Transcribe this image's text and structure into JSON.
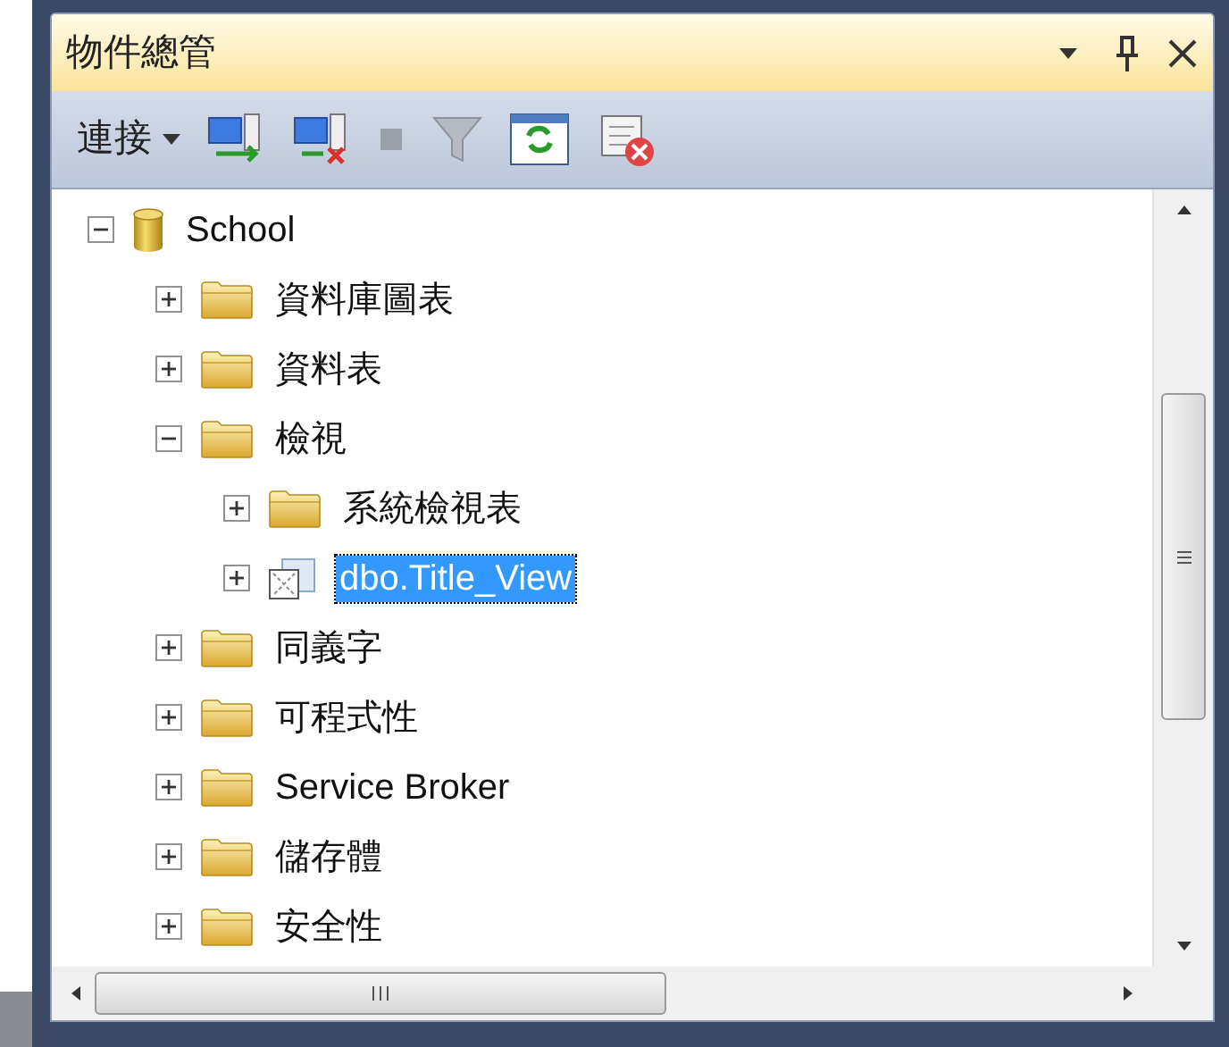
{
  "panel": {
    "title": "物件總管"
  },
  "toolbar": {
    "connect_label": "連接"
  },
  "tree": [
    {
      "label": "School",
      "kind": "database",
      "expanded": true,
      "selected": false,
      "children": [
        {
          "label": "資料庫圖表",
          "kind": "folder",
          "expanded": false,
          "selected": false
        },
        {
          "label": "資料表",
          "kind": "folder",
          "expanded": false,
          "selected": false
        },
        {
          "label": "檢視",
          "kind": "folder",
          "expanded": true,
          "selected": false,
          "children": [
            {
              "label": "系統檢視表",
              "kind": "folder",
              "expanded": false,
              "selected": false
            },
            {
              "label": "dbo.Title_View",
              "kind": "view",
              "expanded": false,
              "selected": true
            }
          ]
        },
        {
          "label": "同義字",
          "kind": "folder",
          "expanded": false,
          "selected": false
        },
        {
          "label": "可程式性",
          "kind": "folder",
          "expanded": false,
          "selected": false
        },
        {
          "label": "Service Broker",
          "kind": "folder",
          "expanded": false,
          "selected": false
        },
        {
          "label": "儲存體",
          "kind": "folder",
          "expanded": false,
          "selected": false
        },
        {
          "label": "安全性",
          "kind": "folder",
          "expanded": false,
          "selected": false
        }
      ]
    }
  ]
}
